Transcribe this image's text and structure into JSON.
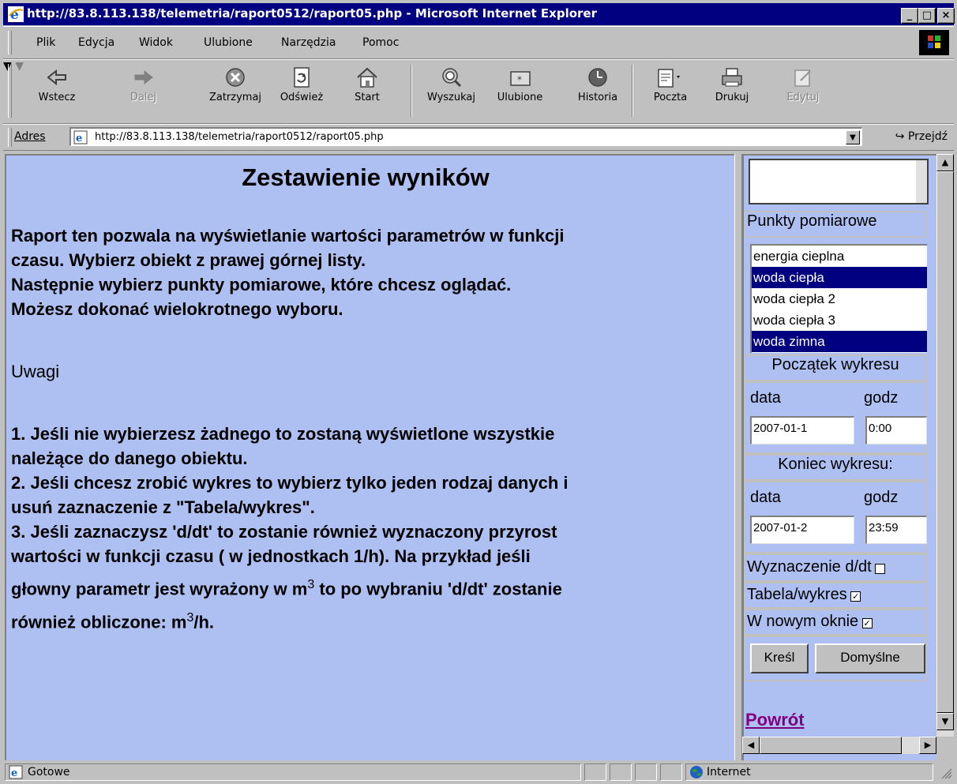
{
  "window": {
    "title": "http://83.8.113.138/telemetria/raport0512/raport05.php - Microsoft Internet Explorer",
    "min": "_",
    "max": "□",
    "close": "×"
  },
  "menu": [
    "Plik",
    "Edycja",
    "Widok",
    "Ulubione",
    "Narzędzia",
    "Pomoc"
  ],
  "toolbar": {
    "back": "Wstecz",
    "forward": "Dalej",
    "stop": "Zatrzymaj",
    "refresh": "Odśwież",
    "home": "Start",
    "search": "Wyszukaj",
    "favorites": "Ulubione",
    "history": "Historia",
    "mail": "Poczta",
    "print": "Drukuj",
    "edit": "Edytuj"
  },
  "address": {
    "label": "Adres",
    "url": "http://83.8.113.138/telemetria/raport0512/raport05.php",
    "go": "Przejdź"
  },
  "main": {
    "heading": "Zestawienie wyników",
    "lines": [
      "Raport ten pozwala na wyświetlanie wartości parametrów w funkcji",
      "czasu. Wybierz obiekt z prawej górnej listy.",
      "Następnie wybierz punkty pomiarowe, które chcesz oglądać.",
      "Możesz dokonać wielokrotnego wyboru.",
      "Uwagi",
      "1. Jeśli nie wybierzesz żadnego to zostaną wyświetlone wszystkie",
      "należące do danego obiektu.",
      "2. Jeśli chcesz zrobić wykres to wybierz tylko jeden rodzaj danych i",
      "usuń zaznaczenie z \"Tabela/wykres\".",
      "3. Jeśli zaznaczysz 'd/dt' to zostanie również wyznaczony przyrost",
      "wartości w funkcji czasu ( w jednostkach 1/h). Na przykład jeśli"
    ],
    "line12_pre": "głowny parametr jest wyrażony w m",
    "line12_sup": "3",
    "line12_post": " to po wybraniu 'd/dt' zostanie",
    "line13_pre": "również obliczone: m",
    "line13_sup": "3",
    "line13_post": "/h."
  },
  "side": {
    "points_label": "Punkty pomiarowe",
    "points": [
      {
        "label": "energia cieplna",
        "selected": false
      },
      {
        "label": "woda ciepła",
        "selected": true
      },
      {
        "label": "woda ciepła 2",
        "selected": false
      },
      {
        "label": "woda ciepła 3",
        "selected": false
      },
      {
        "label": "woda zimna",
        "selected": true
      }
    ],
    "start_label": "Początek wykresu",
    "end_label": "Koniec wykresu:",
    "date_label": "data",
    "hour_label": "godz",
    "start_date": "2007-01-1",
    "start_hour": "0:00",
    "end_date": "2007-01-2",
    "end_hour": "23:59",
    "ddt_label": "Wyznaczenie d/dt",
    "ddt_checked": false,
    "table_label": "Tabela/wykres",
    "table_checked": true,
    "newwin_label": "W nowym oknie",
    "newwin_checked": true,
    "draw_button": "Kreśl",
    "default_button": "Domyślne",
    "back_link": "Powrót"
  },
  "status": {
    "text": "Gotowe",
    "zone": "Internet"
  },
  "colors": {
    "page_bg": "#aebff1",
    "titlebar": "#000080",
    "selection": "#000080",
    "link_visited": "#800080"
  }
}
